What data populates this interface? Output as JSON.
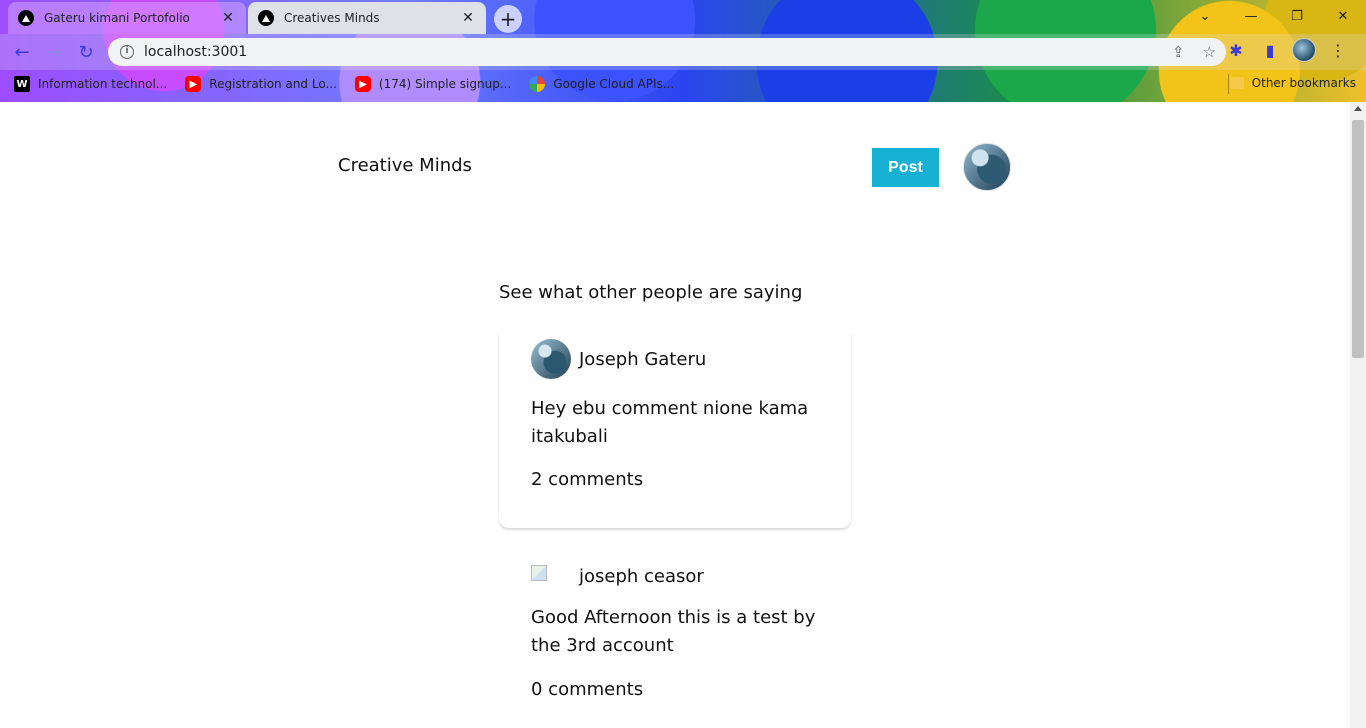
{
  "browser": {
    "tabs": [
      {
        "title": "Gateru kimani Portofolio",
        "active": false
      },
      {
        "title": "Creatives Minds",
        "active": true
      }
    ],
    "url": "localhost:3001",
    "bookmarks": [
      {
        "label": "Information technol...",
        "icon": "wikipedia-icon"
      },
      {
        "label": "Registration and Lo...",
        "icon": "youtube-icon"
      },
      {
        "label": "(174) Simple signup...",
        "icon": "youtube-icon"
      },
      {
        "label": "Google Cloud APIs...",
        "icon": "google-cloud-icon"
      }
    ],
    "other_bookmarks": "Other bookmarks"
  },
  "header": {
    "brand": "Creative Minds",
    "post_button": "Post"
  },
  "feed": {
    "heading": "See what other people are saying",
    "posts": [
      {
        "author": "Joseph Gateru",
        "text": "Hey ebu comment nione kama itakubali",
        "comments": "2 comments"
      },
      {
        "author": "joseph ceasor",
        "text": "Good Afternoon this is a test by the 3rd account",
        "comments": "0 comments"
      }
    ]
  },
  "colors": {
    "accent": "#16b1d3",
    "text": "#111111"
  }
}
